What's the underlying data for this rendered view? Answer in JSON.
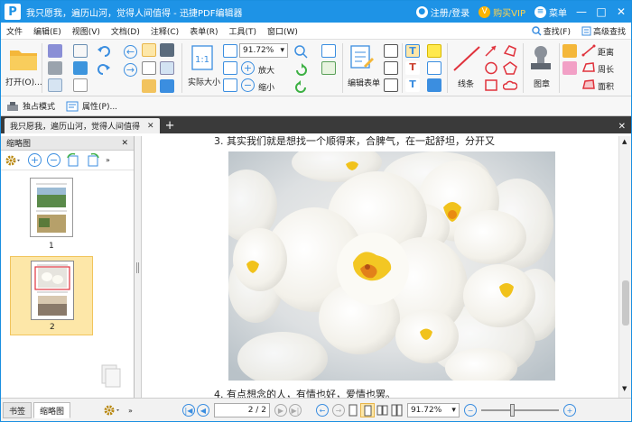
{
  "titlebar": {
    "logo": "P",
    "title": "我只愿我，遍历山河，觉得人间值得 - 迅捷PDF编辑器",
    "login": "注册/登录",
    "vip": "购买VIP",
    "menu": "菜单",
    "minimize": "—",
    "restore": "□",
    "close": "✕"
  },
  "menubar": {
    "items": [
      "文件",
      "编辑(E)",
      "视图(V)",
      "文档(D)",
      "注释(C)",
      "表单(R)",
      "工具(T)",
      "窗口(W)"
    ],
    "find": "查找(F)",
    "adv_find": "高级查找"
  },
  "ribbon": {
    "open": "打开(O)...",
    "actual_size": "实际大小",
    "zoom_value": "91.72%",
    "zoom_in": "放大",
    "zoom_out": "缩小",
    "edit_form": "编辑表单",
    "lines": "线条",
    "stamp": "图章",
    "distance": "距离",
    "perimeter": "周长",
    "area": "面积"
  },
  "modebar": {
    "solo_mode": "独占模式",
    "properties": "属性(P)..."
  },
  "doctab": {
    "title": "我只愿我，遍历山河，觉得人间值得",
    "close": "✕",
    "add": "+"
  },
  "sidebar": {
    "title": "缩略图",
    "close": "✕",
    "page1": "1",
    "page2": "2"
  },
  "document": {
    "line_top": "3. 其实我们就是想找一个顺得来，合脾气，在一起舒坦，分开又",
    "line_bottom": "4. 有点想念的人，有情也好，爱情也罢。"
  },
  "statusbar": {
    "tab_bookmarks": "书签",
    "tab_thumbnails": "缩略图",
    "page_field": "2 / 2",
    "zoom_value": "91.72%"
  },
  "colors": {
    "titlebar": "#1e93e6",
    "accent": "#3b8ee0",
    "thumb_selected": "#fde7a8"
  }
}
